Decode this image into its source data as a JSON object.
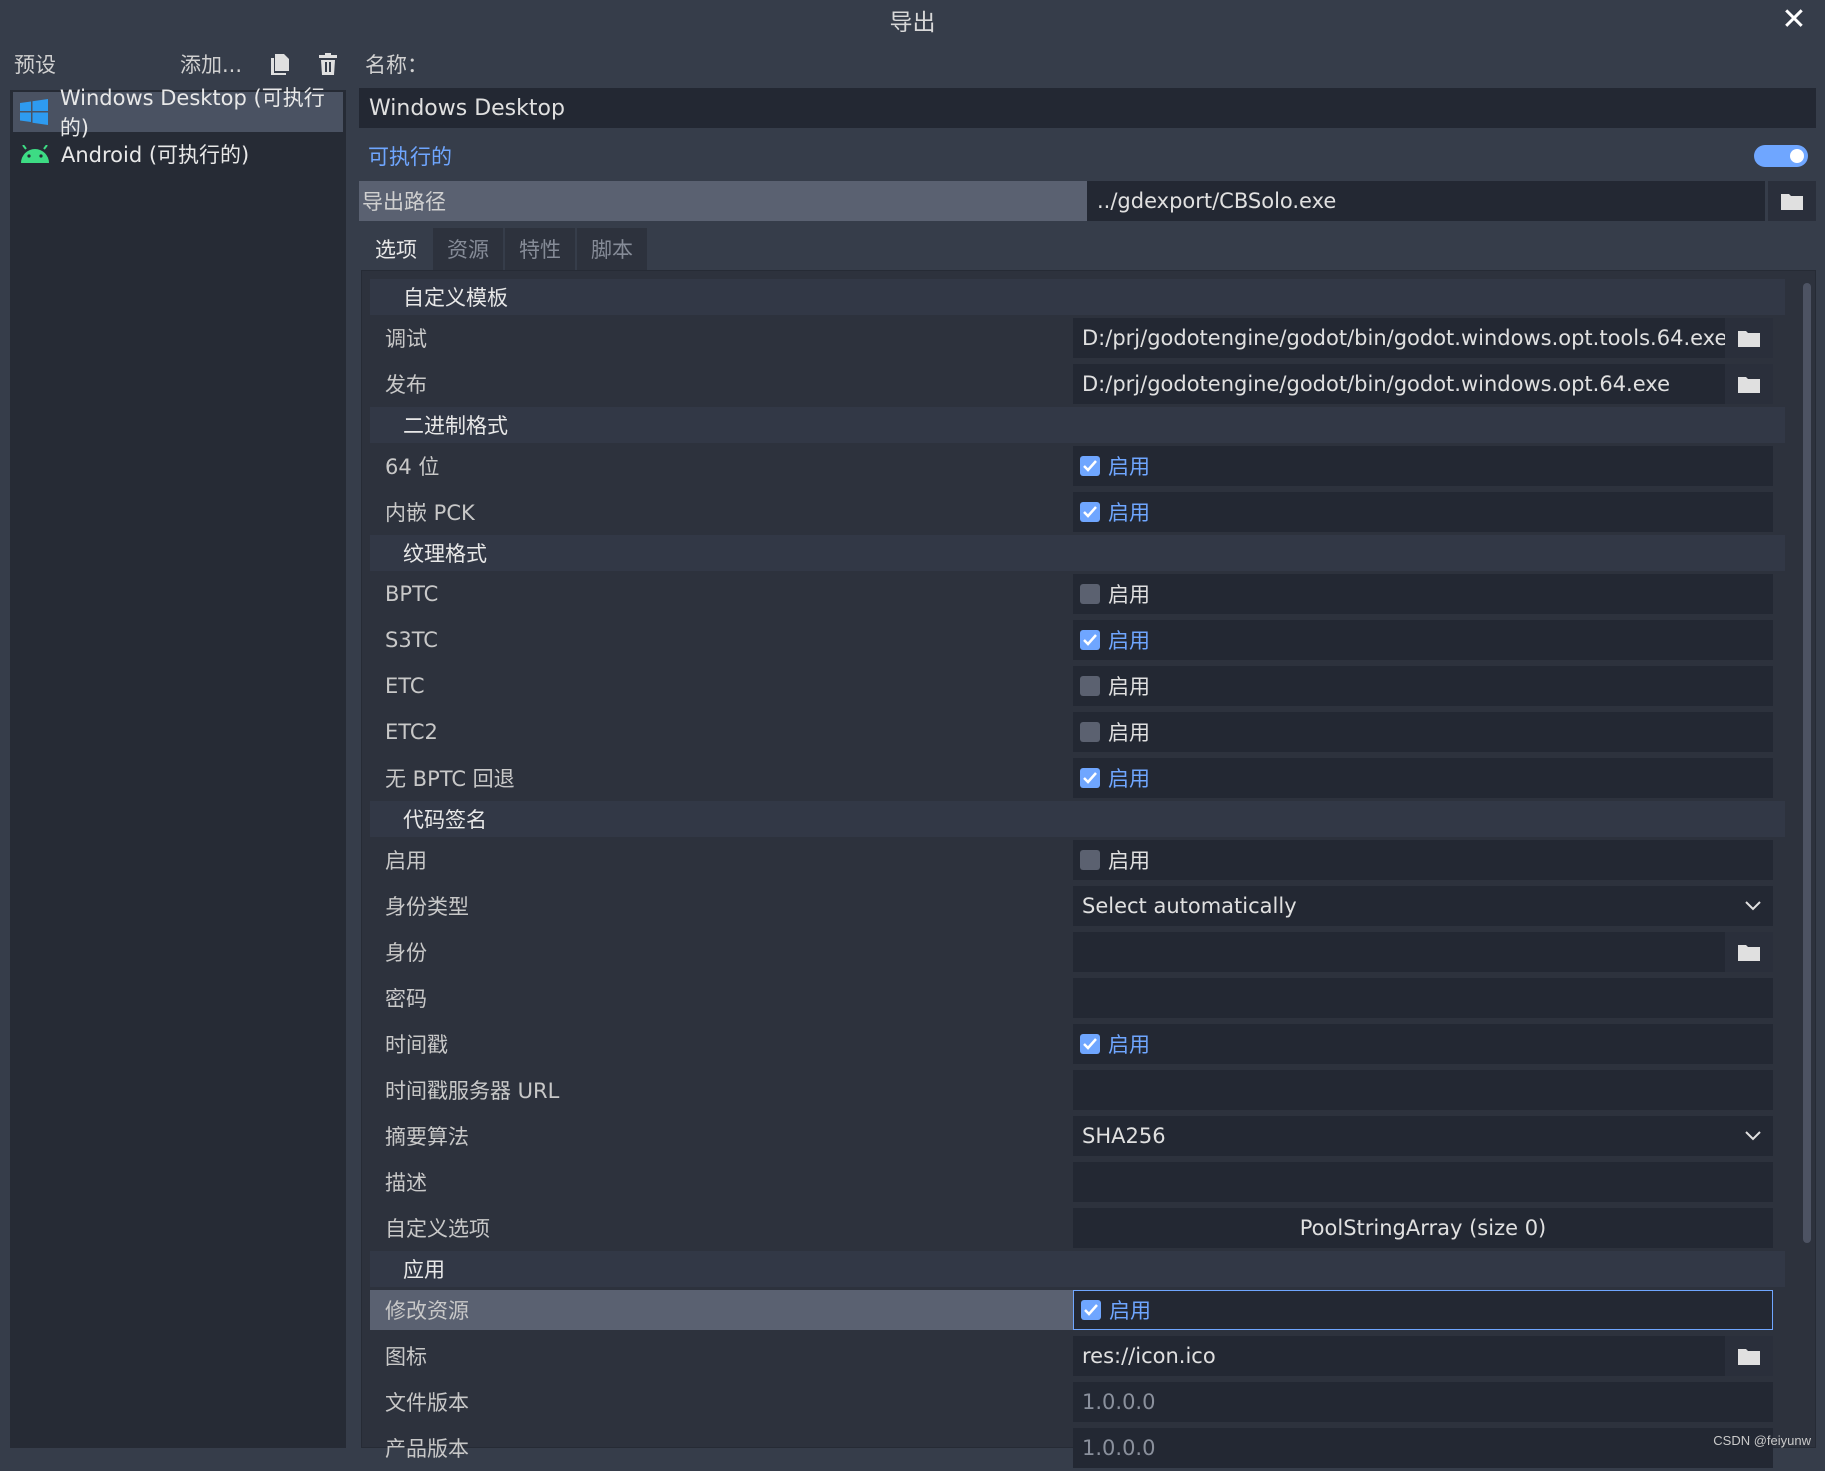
{
  "window": {
    "title": "导出",
    "close_icon": "close-icon"
  },
  "presets": {
    "label": "预设",
    "add_label": "添加...",
    "items": [
      {
        "label": "Windows Desktop (可执行的)",
        "icon": "windows-icon",
        "selected": true
      },
      {
        "label": "Android (可执行的)",
        "icon": "android-icon",
        "selected": false
      }
    ]
  },
  "right": {
    "name_label": "名称：",
    "name_value": "Windows Desktop",
    "runnable_label": "可执行的",
    "runnable_on": true,
    "export_path_label": "导出路径",
    "export_path_value": "../gdexport/CBSolo.exe",
    "tabs": [
      "选项",
      "资源",
      "特性",
      "脚本"
    ],
    "active_tab": 0
  },
  "inspector": {
    "sections": {
      "custom_template": "自定义模板",
      "binary_format": "二进制格式",
      "texture_format": "纹理格式",
      "codesign": "代码签名",
      "application": "应用"
    },
    "enable_label": "启用",
    "props": {
      "debug": {
        "label": "调试",
        "value": "D:/prj/godotengine/godot/bin/godot.windows.opt.tools.64.exe"
      },
      "release": {
        "label": "发布",
        "value": "D:/prj/godotengine/godot/bin/godot.windows.opt.64.exe"
      },
      "bits64": {
        "label": "64 位",
        "checked": true
      },
      "embed_pck": {
        "label": "内嵌 PCK",
        "checked": true
      },
      "bptc": {
        "label": "BPTC",
        "checked": false
      },
      "s3tc": {
        "label": "S3TC",
        "checked": true
      },
      "etc": {
        "label": "ETC",
        "checked": false
      },
      "etc2": {
        "label": "ETC2",
        "checked": false
      },
      "no_bptc_fallback": {
        "label": "无 BPTC 回退",
        "checked": true
      },
      "cs_enable": {
        "label": "启用",
        "checked": false
      },
      "identity_type": {
        "label": "身份类型",
        "value": "Select automatically"
      },
      "identity": {
        "label": "身份",
        "value": ""
      },
      "password": {
        "label": "密码",
        "value": ""
      },
      "timestamp": {
        "label": "时间戳",
        "checked": true
      },
      "timestamp_url": {
        "label": "时间戳服务器 URL",
        "value": ""
      },
      "digest": {
        "label": "摘要算法",
        "value": "SHA256"
      },
      "description": {
        "label": "描述",
        "value": ""
      },
      "custom_options": {
        "label": "自定义选项",
        "value": "PoolStringArray (size 0)"
      },
      "modify_resources": {
        "label": "修改资源",
        "checked": true
      },
      "icon": {
        "label": "图标",
        "value": "res://icon.ico"
      },
      "file_version": {
        "label": "文件版本",
        "value": "1.0.0.0"
      },
      "product_version": {
        "label": "产品版本",
        "value": "1.0.0.0"
      }
    }
  },
  "watermark": "CSDN @feiyunw",
  "colors": {
    "accent": "#6fa6ff",
    "background": "#363d4a",
    "field": "#232833"
  }
}
